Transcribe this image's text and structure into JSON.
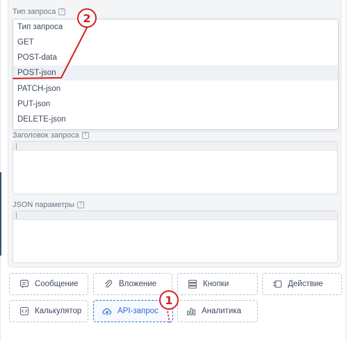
{
  "request_type": {
    "label": "Тип запроса",
    "help": "?",
    "options": [
      "Тип запроса",
      "GET",
      "POST-data",
      "POST-json",
      "PATCH-json",
      "PUT-json",
      "DELETE-json"
    ],
    "highlighted": "POST-json"
  },
  "headers": {
    "label": "Заголовок запроса",
    "help": "?",
    "value": ""
  },
  "json_params": {
    "label": "JSON параметры",
    "help": "?",
    "value": ""
  },
  "blocks": {
    "message": "Сообщение",
    "attachment": "Вложение",
    "buttons": "Кнопки",
    "action": "Действие",
    "calculator": "Калькулятор",
    "api": "API-запрос",
    "analytics": "Аналитика",
    "active": "API-запрос"
  },
  "markers": {
    "one": "1",
    "two": "2"
  },
  "colors": {
    "accent": "#2e6dd1",
    "annotation": "#d42020",
    "text": "#3d4a5c"
  },
  "icons": [
    "message-icon",
    "attachment-icon",
    "buttons-icon",
    "action-icon",
    "code-icon",
    "cloud-upload-icon",
    "analytics-icon"
  ]
}
